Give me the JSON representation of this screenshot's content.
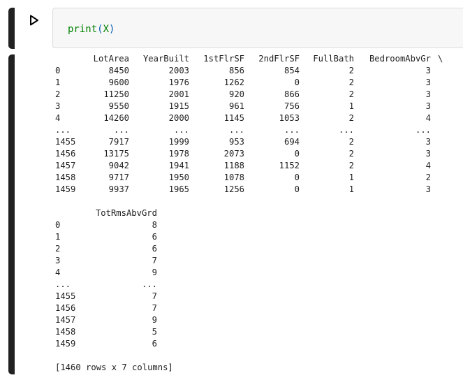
{
  "cell": {
    "code_fn": "print",
    "code_open": "(",
    "code_arg": "X",
    "code_close": ")"
  },
  "output": {
    "table1": {
      "columns": [
        "LotArea",
        "YearBuilt",
        "1stFlrSF",
        "2ndFlrSF",
        "FullBath",
        "BedroomAbvGr"
      ],
      "continuation": "\\",
      "rows": [
        [
          "0",
          "8450",
          "2003",
          "856",
          "854",
          "2",
          "3"
        ],
        [
          "1",
          "9600",
          "1976",
          "1262",
          "0",
          "2",
          "3"
        ],
        [
          "2",
          "11250",
          "2001",
          "920",
          "866",
          "2",
          "3"
        ],
        [
          "3",
          "9550",
          "1915",
          "961",
          "756",
          "1",
          "3"
        ],
        [
          "4",
          "14260",
          "2000",
          "1145",
          "1053",
          "2",
          "4"
        ],
        [
          "...",
          "...",
          "...",
          "...",
          "...",
          "...",
          "..."
        ],
        [
          "1455",
          "7917",
          "1999",
          "953",
          "694",
          "2",
          "3"
        ],
        [
          "1456",
          "13175",
          "1978",
          "2073",
          "0",
          "2",
          "3"
        ],
        [
          "1457",
          "9042",
          "1941",
          "1188",
          "1152",
          "2",
          "4"
        ],
        [
          "1458",
          "9717",
          "1950",
          "1078",
          "0",
          "1",
          "2"
        ],
        [
          "1459",
          "9937",
          "1965",
          "1256",
          "0",
          "1",
          "3"
        ]
      ]
    },
    "table2": {
      "columns": [
        "TotRmsAbvGrd"
      ],
      "rows": [
        [
          "0",
          "8"
        ],
        [
          "1",
          "6"
        ],
        [
          "2",
          "6"
        ],
        [
          "3",
          "7"
        ],
        [
          "4",
          "9"
        ],
        [
          "...",
          "..."
        ],
        [
          "1455",
          "7"
        ],
        [
          "1456",
          "7"
        ],
        [
          "1457",
          "9"
        ],
        [
          "1458",
          "5"
        ],
        [
          "1459",
          "6"
        ]
      ]
    },
    "summary": "[1460 rows x 7 columns]"
  }
}
